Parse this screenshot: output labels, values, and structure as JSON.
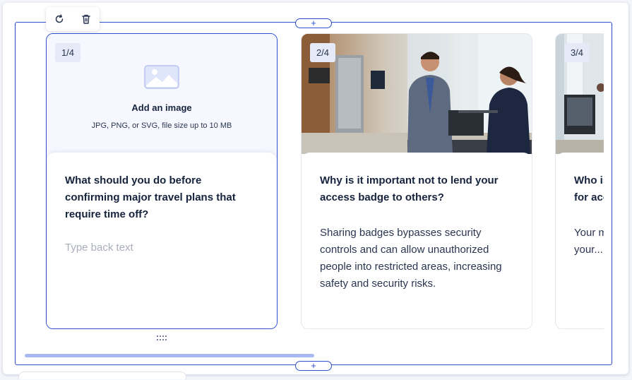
{
  "toolbar": {
    "rotate_icon": "rotate-icon",
    "delete_icon": "trash-icon"
  },
  "add_handle": {
    "symbol": "+"
  },
  "cards": [
    {
      "badge": "1/4",
      "upload_title": "Add an image",
      "upload_hint": "JPG, PNG, or SVG, file size up to 10 MB",
      "question": "What should you do before confirming major travel plans that require time off?",
      "answer_placeholder": "Type back text"
    },
    {
      "badge": "2/4",
      "question": "Why is it important not to lend your access badge to others?",
      "answer": "Sharing badges bypasses security controls and can allow unauthorized people into restricted areas, increasing safety and security risks."
    },
    {
      "badge": "3/4",
      "question": "Who is responsible if you are asked for access to your badge?",
      "answer": "Your manager or contact security to your..."
    }
  ],
  "scroll": {
    "position_fraction": 0.5
  },
  "colors": {
    "accent": "#2f4fd0",
    "scroll_thumb": "#a9b8f2",
    "badge_bg": "#e6e9f8"
  }
}
